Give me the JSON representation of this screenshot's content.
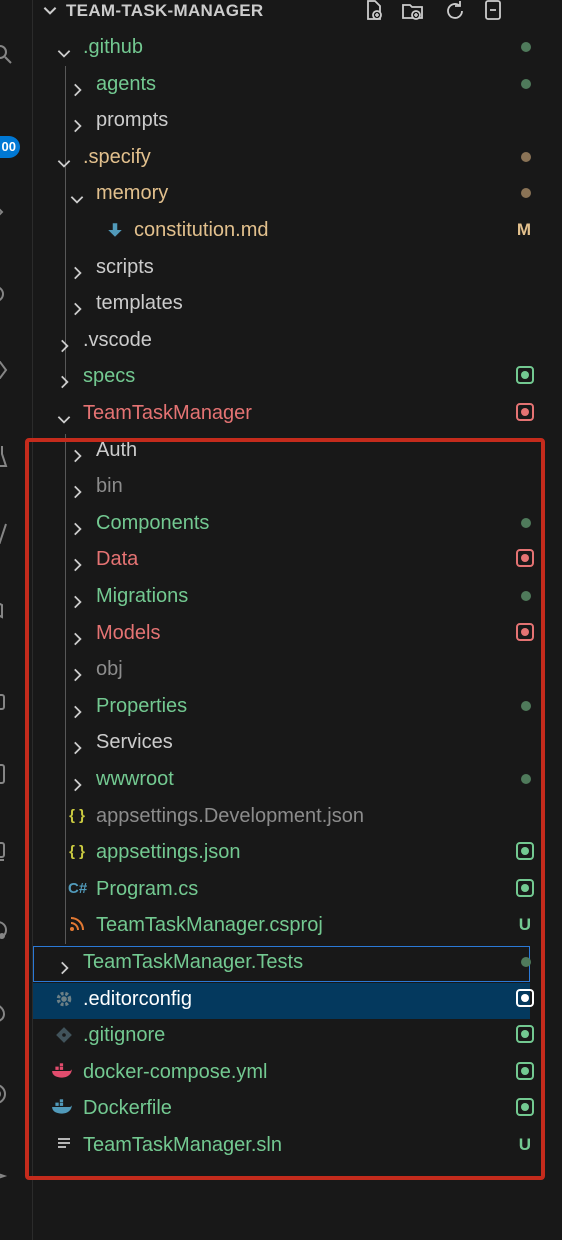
{
  "colors": {
    "background": "#181818",
    "text": "#cccccc",
    "untracked": "#73c991",
    "modified": "#e2c08d",
    "conflict": "#e57373",
    "ignored": "#8c8c8c",
    "selection": "#04395e",
    "focus_border": "#2b79d6",
    "highlight_box": "#c42b1c"
  },
  "activity_bar": {
    "badge": "00",
    "icons": [
      "search-icon",
      "source-control-icon",
      "run-debug-icon",
      "extensions-icon",
      "testing-icon",
      "remote-icon",
      "accounts-icon"
    ]
  },
  "explorer": {
    "title": "TEAM-TASK-MANAGER",
    "actions": [
      "new-file-icon",
      "new-folder-icon",
      "refresh-icon",
      "collapse-all-icon"
    ],
    "rows": [
      {
        "label": ".github",
        "indent": 0,
        "kind": "folder",
        "expanded": true,
        "status": "untracked",
        "decoration": "dot"
      },
      {
        "label": "agents",
        "indent": 1,
        "kind": "folder",
        "expanded": false,
        "status": "untracked",
        "decoration": "dot"
      },
      {
        "label": "prompts",
        "indent": 1,
        "kind": "folder",
        "expanded": false,
        "status": "plain",
        "decoration": "none"
      },
      {
        "label": ".specify",
        "indent": 0,
        "kind": "folder",
        "expanded": true,
        "status": "modified",
        "decoration": "dot"
      },
      {
        "label": "memory",
        "indent": 1,
        "kind": "folder",
        "expanded": true,
        "status": "modified",
        "decoration": "dot"
      },
      {
        "label": "constitution.md",
        "indent": 2,
        "kind": "file",
        "icon": "markdown-icon",
        "status": "modified",
        "decoration": "letter",
        "letter": "M"
      },
      {
        "label": "scripts",
        "indent": 1,
        "kind": "folder",
        "expanded": false,
        "status": "plain",
        "decoration": "none"
      },
      {
        "label": "templates",
        "indent": 1,
        "kind": "folder",
        "expanded": false,
        "status": "plain",
        "decoration": "none"
      },
      {
        "label": ".vscode",
        "indent": 0,
        "kind": "folder",
        "expanded": false,
        "status": "plain",
        "decoration": "none"
      },
      {
        "label": "specs",
        "indent": 0,
        "kind": "folder",
        "expanded": false,
        "status": "untracked",
        "decoration": "box"
      },
      {
        "label": "TeamTaskManager",
        "indent": 0,
        "kind": "folder",
        "expanded": true,
        "status": "conflict",
        "decoration": "box"
      },
      {
        "label": "Auth",
        "indent": 1,
        "kind": "folder",
        "expanded": false,
        "status": "plain",
        "decoration": "none"
      },
      {
        "label": "bin",
        "indent": 1,
        "kind": "folder",
        "expanded": false,
        "status": "ignored",
        "decoration": "none"
      },
      {
        "label": "Components",
        "indent": 1,
        "kind": "folder",
        "expanded": false,
        "status": "untracked",
        "decoration": "dot"
      },
      {
        "label": "Data",
        "indent": 1,
        "kind": "folder",
        "expanded": false,
        "status": "conflict",
        "decoration": "box"
      },
      {
        "label": "Migrations",
        "indent": 1,
        "kind": "folder",
        "expanded": false,
        "status": "untracked",
        "decoration": "dot"
      },
      {
        "label": "Models",
        "indent": 1,
        "kind": "folder",
        "expanded": false,
        "status": "conflict",
        "decoration": "box"
      },
      {
        "label": "obj",
        "indent": 1,
        "kind": "folder",
        "expanded": false,
        "status": "ignored",
        "decoration": "none"
      },
      {
        "label": "Properties",
        "indent": 1,
        "kind": "folder",
        "expanded": false,
        "status": "untracked",
        "decoration": "dot"
      },
      {
        "label": "Services",
        "indent": 1,
        "kind": "folder",
        "expanded": false,
        "status": "plain",
        "decoration": "none"
      },
      {
        "label": "wwwroot",
        "indent": 1,
        "kind": "folder",
        "expanded": false,
        "status": "untracked",
        "decoration": "dot"
      },
      {
        "label": "appsettings.Development.json",
        "indent": 1,
        "kind": "file",
        "icon": "json-icon",
        "status": "ignored",
        "decoration": "none"
      },
      {
        "label": "appsettings.json",
        "indent": 1,
        "kind": "file",
        "icon": "json-icon",
        "status": "untracked",
        "decoration": "box"
      },
      {
        "label": "Program.cs",
        "indent": 1,
        "kind": "file",
        "icon": "csharp-icon",
        "status": "untracked",
        "decoration": "box"
      },
      {
        "label": "TeamTaskManager.csproj",
        "indent": 1,
        "kind": "file",
        "icon": "rss-icon",
        "status": "untracked",
        "decoration": "letter",
        "letter": "U"
      },
      {
        "label": "TeamTaskManager.Tests",
        "indent": 0,
        "kind": "folder",
        "expanded": false,
        "status": "untracked",
        "decoration": "dot",
        "focused": true
      },
      {
        "label": ".editorconfig",
        "indent": 0,
        "kind": "file",
        "icon": "gear-icon",
        "status": "selected",
        "decoration": "box",
        "selected": true
      },
      {
        "label": ".gitignore",
        "indent": 0,
        "kind": "file",
        "icon": "git-icon",
        "status": "untracked",
        "decoration": "box"
      },
      {
        "label": "docker-compose.yml",
        "indent": 0,
        "kind": "file",
        "icon": "docker-compose-icon",
        "status": "untracked",
        "decoration": "box"
      },
      {
        "label": "Dockerfile",
        "indent": 0,
        "kind": "file",
        "icon": "docker-icon",
        "status": "untracked",
        "decoration": "box"
      },
      {
        "label": "TeamTaskManager.sln",
        "indent": 0,
        "kind": "file",
        "icon": "lines-icon",
        "status": "untracked",
        "decoration": "letter",
        "letter": "U"
      }
    ]
  }
}
